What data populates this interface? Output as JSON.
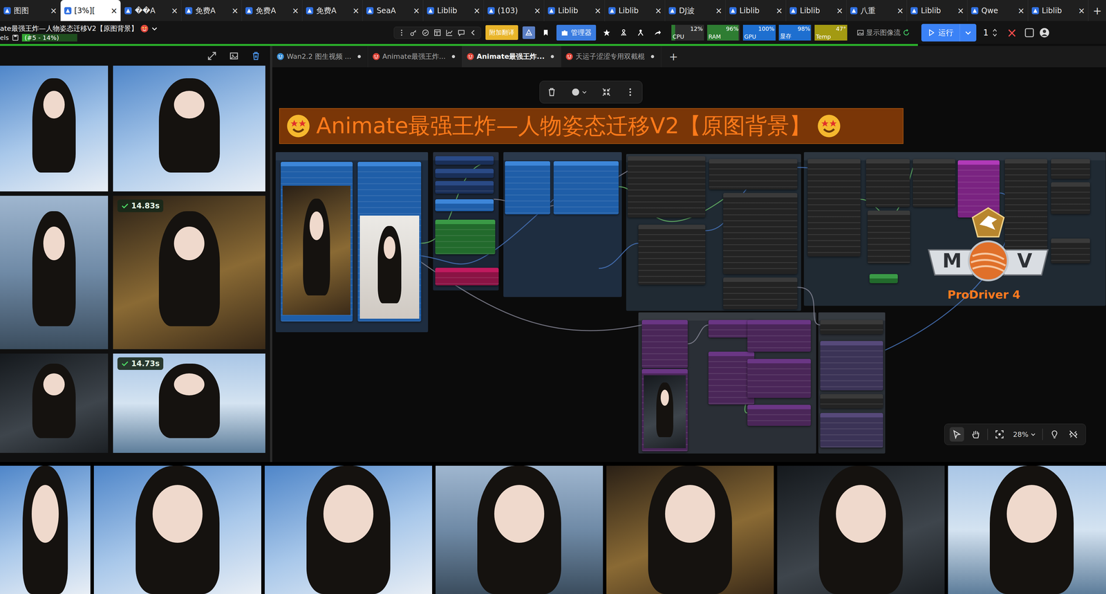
{
  "browser": {
    "tabs": [
      {
        "label": "图图",
        "selected": false
      },
      {
        "label": "[3%][",
        "selected": true
      },
      {
        "label": "��A",
        "selected": false
      },
      {
        "label": "免费A",
        "selected": false
      },
      {
        "label": "免费A",
        "selected": false
      },
      {
        "label": "免费A",
        "selected": false
      },
      {
        "label": "SeaA",
        "selected": false
      },
      {
        "label": "Liblib",
        "selected": false
      },
      {
        "label": "(103)",
        "selected": false
      },
      {
        "label": "Liblib",
        "selected": false
      },
      {
        "label": "Liblib",
        "selected": false
      },
      {
        "label": "DJ波",
        "selected": false
      },
      {
        "label": "Liblib",
        "selected": false
      },
      {
        "label": "Liblib",
        "selected": false
      },
      {
        "label": "八重",
        "selected": false
      },
      {
        "label": "Liblib",
        "selected": false
      },
      {
        "label": "Qwe",
        "selected": false
      },
      {
        "label": "Liblib",
        "selected": false
      }
    ],
    "close": "×",
    "new_tab": "+"
  },
  "topbar": {
    "title": "ate最强王炸—人物姿态迁移V2【原图背景】",
    "subtitle": "els",
    "queue": "(#5 - 14%)",
    "queue_level": 0.14,
    "translate": "附加翻译",
    "manager": "管理器",
    "monitors": [
      {
        "label": "CPU",
        "value": "12%",
        "level": 0.12,
        "color": "#2e7d32"
      },
      {
        "label": "RAM",
        "value": "96%",
        "level": 0.96,
        "color": "#2e7d32"
      },
      {
        "label": "GPU",
        "value": "100%",
        "level": 1,
        "color": "#1e6fd0"
      },
      {
        "label": "显存",
        "value": "98%",
        "level": 0.98,
        "color": "#1e6fd0"
      },
      {
        "label": "Temp",
        "value": "47°",
        "level": 1,
        "color": "#a39a12"
      }
    ],
    "image_flow": "显示图像流",
    "run": "运行",
    "batch": "1",
    "close": "×",
    "progress_level": 0.83
  },
  "gallery": {
    "images": [
      {
        "badge": null
      },
      {
        "badge": null
      },
      {
        "badge": null
      },
      {
        "badge": "14.83s"
      },
      {
        "badge": null
      },
      {
        "badge": "14.73s"
      }
    ]
  },
  "bottom_strip": {
    "images": [
      {
        "badge": null
      },
      {
        "badge": null
      },
      {
        "badge": null
      },
      {
        "badge": null
      },
      {
        "badge": null
      },
      {
        "badge": null
      },
      {
        "badge": null
      }
    ]
  },
  "workflow_tabs": [
    {
      "label": "Wan2.2 图生视频 ...",
      "selected": false,
      "modified": true
    },
    {
      "label": "Animate最强王炸...",
      "selected": false,
      "modified": true
    },
    {
      "label": "Animate最强王炸...",
      "selected": true,
      "modified": true
    },
    {
      "label": "天运子涩涩专用双截棍",
      "selected": false,
      "modified": true
    }
  ],
  "workflow_new_tab": "+",
  "canvas": {
    "banner": "Animate最强王炸—人物姿态迁移V2【原图背景】",
    "zoom": "28%",
    "logo": {
      "left": "M",
      "right": "V",
      "name": "ProDriver 4"
    }
  }
}
